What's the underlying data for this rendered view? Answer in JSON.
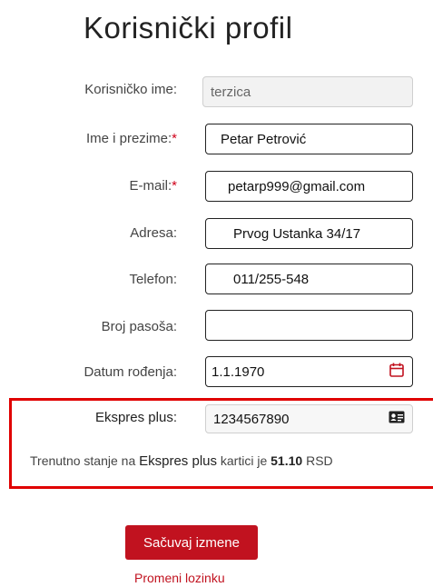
{
  "page": {
    "title": "Korisnički profil"
  },
  "fields": {
    "username": {
      "label": "Korisničko ime:",
      "value": "terzica"
    },
    "full_name": {
      "label": "Ime i prezime:",
      "required_mark": "*",
      "value": "Petar Petrović"
    },
    "email": {
      "label": "E-mail:",
      "required_mark": "*",
      "value": "petarp999@gmail.com"
    },
    "address": {
      "label": "Adresa:",
      "value": "Prvog Ustanka 34/17"
    },
    "phone": {
      "label": "Telefon:",
      "value": "011/255-548"
    },
    "passport": {
      "label": "Broj pasoša:",
      "value": ""
    },
    "birth_date": {
      "label": "Datum rođenja:",
      "value": "1.1.1970",
      "icon": "calendar-icon"
    },
    "ekspres_plus": {
      "label": "Ekspres plus:",
      "value": "1234567890",
      "icon": "id-card-icon"
    }
  },
  "balance": {
    "prefix": "Trenutno stanje na",
    "card_name": "Ekspres plus",
    "middle": "kartici je",
    "amount": "51.10",
    "currency": "RSD"
  },
  "actions": {
    "save_label": "Sačuvaj izmene",
    "change_password_label": "Promeni lozinku"
  },
  "colors": {
    "accent": "#c1121f",
    "highlight_border": "#e00000",
    "required": "#d0021b"
  }
}
